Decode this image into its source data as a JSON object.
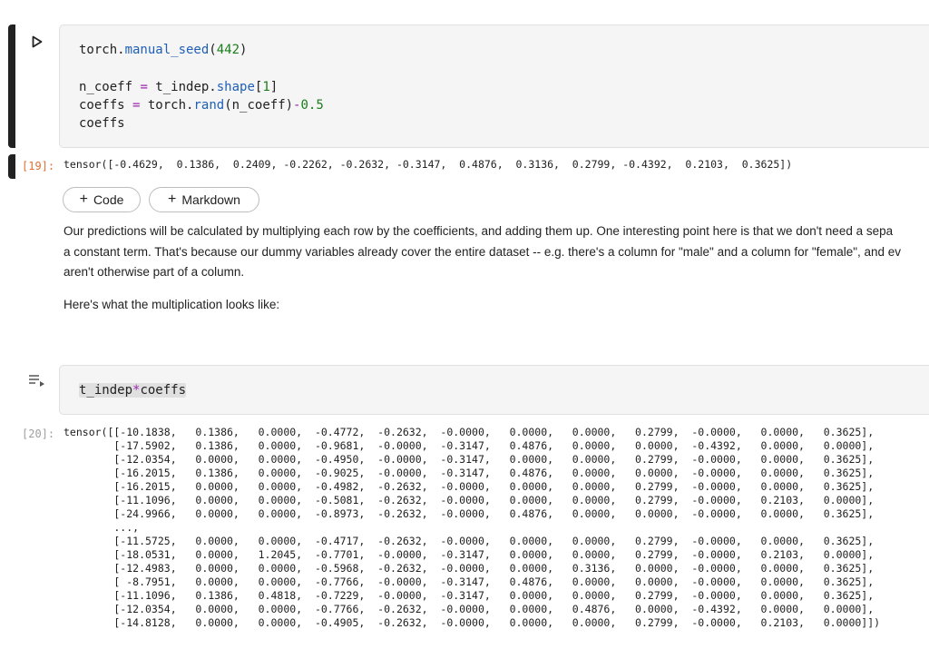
{
  "cell1": {
    "code_lines": [
      [
        {
          "t": "torch."
        },
        {
          "t": "manual_seed",
          "c": "fn"
        },
        {
          "t": "("
        },
        {
          "t": "442",
          "c": "num"
        },
        {
          "t": ")"
        }
      ],
      [],
      [
        {
          "t": "n_coeff "
        },
        {
          "t": "=",
          "c": "op"
        },
        {
          "t": " t_indep."
        },
        {
          "t": "shape",
          "c": "fn"
        },
        {
          "t": "["
        },
        {
          "t": "1",
          "c": "num"
        },
        {
          "t": "]"
        }
      ],
      [
        {
          "t": "coeffs "
        },
        {
          "t": "=",
          "c": "op"
        },
        {
          "t": " torch."
        },
        {
          "t": "rand",
          "c": "fn"
        },
        {
          "t": "(n_coeff)"
        },
        {
          "t": "-",
          "c": "op"
        },
        {
          "t": "0.5",
          "c": "num"
        }
      ],
      [
        {
          "t": "coeffs"
        }
      ]
    ],
    "output_prompt": "[19]:",
    "output_text": "tensor([-0.4629,  0.1386,  0.2409, -0.2262, -0.2632, -0.3147,  0.4876,  0.3136,  0.2799, -0.4392,  0.2103,  0.3625])"
  },
  "toolbar": {
    "add_code_label": "Code",
    "add_markdown_label": "Markdown"
  },
  "markdown": {
    "line1": "Our predictions will be calculated by multiplying each row by the coefficients, and adding them up. One interesting point here is that we don't need a sepa",
    "line2": "a constant term. That's because our dummy variables already cover the entire dataset -- e.g. there's a column for \"male\" and a column for \"female\", and ev",
    "line3": "aren't otherwise part of a column.",
    "line4": "Here's what the multiplication looks like:"
  },
  "cell2": {
    "code_var": "t_indep",
    "code_op": "*",
    "code_var2": "coeffs",
    "output_prompt": "[20]:",
    "output_lines": [
      "tensor([[-10.1838,   0.1386,   0.0000,  -0.4772,  -0.2632,  -0.0000,   0.0000,   0.0000,   0.2799,  -0.0000,   0.0000,   0.3625],",
      "        [-17.5902,   0.1386,   0.0000,  -0.9681,  -0.0000,  -0.3147,   0.4876,   0.0000,   0.0000,  -0.4392,   0.0000,   0.0000],",
      "        [-12.0354,   0.0000,   0.0000,  -0.4950,  -0.0000,  -0.3147,   0.0000,   0.0000,   0.2799,  -0.0000,   0.0000,   0.3625],",
      "        [-16.2015,   0.1386,   0.0000,  -0.9025,  -0.0000,  -0.3147,   0.4876,   0.0000,   0.0000,  -0.0000,   0.0000,   0.3625],",
      "        [-16.2015,   0.0000,   0.0000,  -0.4982,  -0.2632,  -0.0000,   0.0000,   0.0000,   0.2799,  -0.0000,   0.0000,   0.3625],",
      "        [-11.1096,   0.0000,   0.0000,  -0.5081,  -0.2632,  -0.0000,   0.0000,   0.0000,   0.2799,  -0.0000,   0.2103,   0.0000],",
      "        [-24.9966,   0.0000,   0.0000,  -0.8973,  -0.2632,  -0.0000,   0.4876,   0.0000,   0.0000,  -0.0000,   0.0000,   0.3625],",
      "        ...,",
      "        [-11.5725,   0.0000,   0.0000,  -0.4717,  -0.2632,  -0.0000,   0.0000,   0.0000,   0.2799,  -0.0000,   0.0000,   0.3625],",
      "        [-18.0531,   0.0000,   1.2045,  -0.7701,  -0.0000,  -0.3147,   0.0000,   0.0000,   0.2799,  -0.0000,   0.2103,   0.0000],",
      "        [-12.4983,   0.0000,   0.0000,  -0.5968,  -0.2632,  -0.0000,   0.0000,   0.3136,   0.0000,  -0.0000,   0.0000,   0.3625],",
      "        [ -8.7951,   0.0000,   0.0000,  -0.7766,  -0.0000,  -0.3147,   0.4876,   0.0000,   0.0000,  -0.0000,   0.0000,   0.3625],",
      "        [-11.1096,   0.1386,   0.4818,  -0.7229,  -0.0000,  -0.3147,   0.0000,   0.0000,   0.2799,  -0.0000,   0.0000,   0.3625],",
      "        [-12.0354,   0.0000,   0.0000,  -0.7766,  -0.2632,  -0.0000,   0.0000,   0.4876,   0.0000,  -0.4392,   0.0000,   0.0000],",
      "        [-14.8128,   0.0000,   0.0000,  -0.4905,  -0.2632,  -0.0000,   0.0000,   0.0000,   0.2799,  -0.0000,   0.2103,   0.0000]])"
    ]
  },
  "colors": {
    "prompt": "#e07034",
    "function": "#1f5fb5",
    "number": "#1a7d1a",
    "operator": "#9c27b0",
    "cell_bg": "#f5f5f5",
    "active_bar": "#212121"
  },
  "icons": {
    "run": "play-icon",
    "cell_menu": "cell-menu-icon"
  }
}
